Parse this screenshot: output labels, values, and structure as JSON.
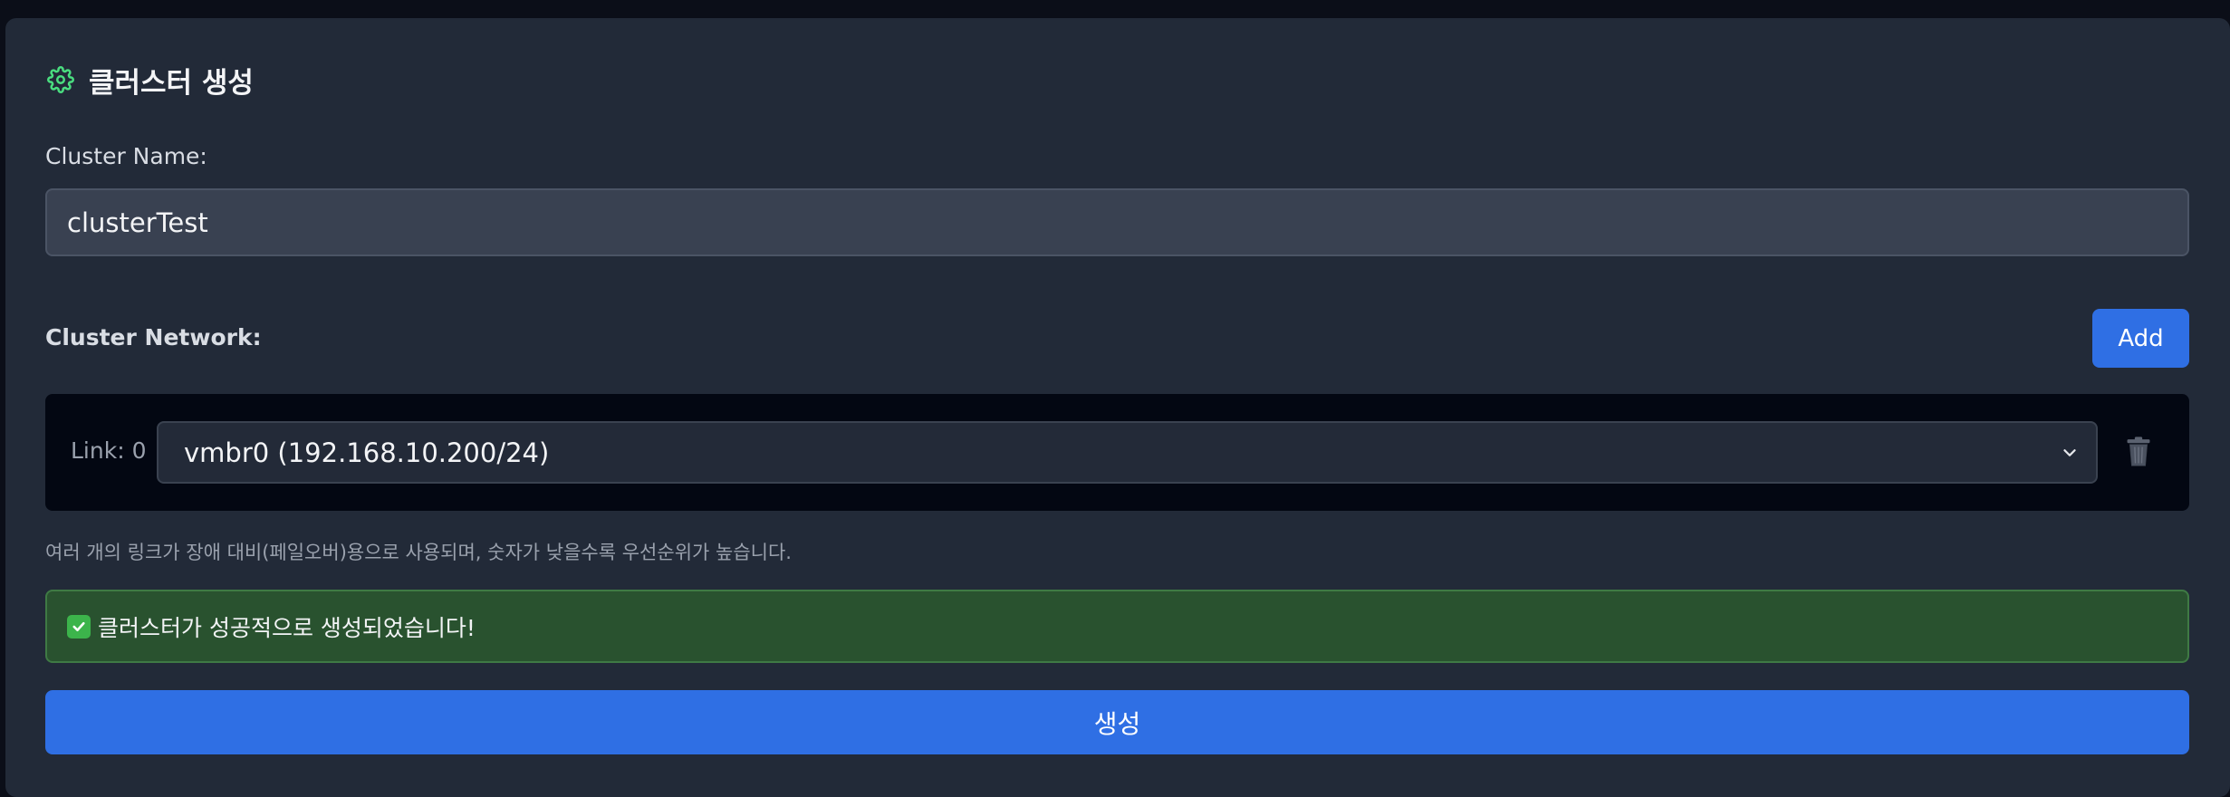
{
  "header": {
    "title": "클러스터 생성",
    "icon": "gear-icon"
  },
  "form": {
    "cluster_name_label": "Cluster Name:",
    "cluster_name_value": "clusterTest",
    "cluster_network_label": "Cluster Network:",
    "add_button_label": "Add",
    "links": [
      {
        "label": "Link: 0",
        "selected": "vmbr0 (192.168.10.200/24)"
      }
    ],
    "hint": "여러 개의 링크가 장애 대비(페일오버)용으로 사용되며, 숫자가 낮을수록 우선순위가 높습니다.",
    "success_message": "클러스터가 성공적으로 생성되었습니다!",
    "submit_label": "생성"
  },
  "colors": {
    "accent": "#2f6fe4",
    "success_bg": "#29522f",
    "gear_icon": "#4ade80",
    "panel_bg": "#222a38"
  }
}
